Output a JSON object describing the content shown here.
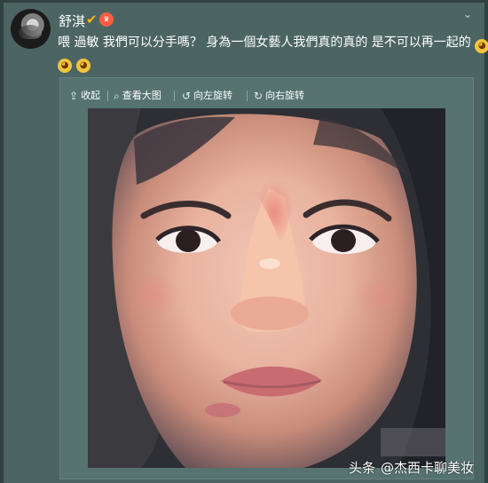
{
  "post": {
    "username": "舒淇",
    "verified_icon": "verified-v-icon",
    "vip_icon": "vip-badge-icon",
    "dropdown_icon": "chevron-down-icon",
    "text": "喂 過敏 我們可以分手嗎？ 身為一個女藝人我們真的真的 是不可以再一起的",
    "emoji_count": 3
  },
  "toolbar": {
    "collapse_label": "收起",
    "view_large_label": "查看大图",
    "rotate_left_label": "向左旋转",
    "rotate_right_label": "向右旋转"
  },
  "photo": {
    "semantic": "selfie-photo"
  },
  "watermark": {
    "platform": "头条",
    "account": "@杰西卡聊美妆"
  }
}
